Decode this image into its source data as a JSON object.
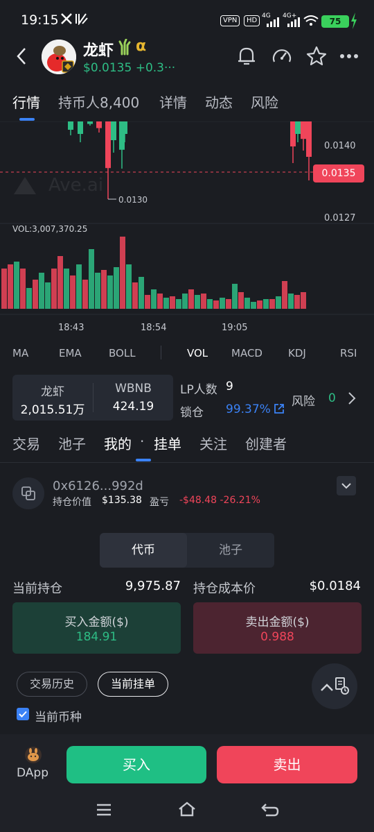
{
  "status_bar": {
    "time": "19:15",
    "vpn": "VPN",
    "hd": "HD",
    "net1": "4G",
    "net2": "4G+",
    "battery": "75"
  },
  "header": {
    "token_name": "龙虾",
    "alpha": "α",
    "price": "$0.0135",
    "change": "+0.3···"
  },
  "tabs": [
    {
      "label": "行情"
    },
    {
      "label": "持币人8,400"
    },
    {
      "label": "详情"
    },
    {
      "label": "动态"
    },
    {
      "label": "风险"
    }
  ],
  "chart_data": {
    "type": "candlestick",
    "price_ticks": [
      "0.0140",
      "0.0127"
    ],
    "low_label": "0.0130",
    "current_price": "0.0135",
    "watermark": "Ave.ai",
    "volume_label": "VOL:3,007,370.25",
    "time_ticks": [
      "18:43",
      "18:54",
      "19:05"
    ]
  },
  "indicators": [
    "MA",
    "EMA",
    "BOLL",
    "VOL",
    "MACD",
    "KDJ",
    "RSI"
  ],
  "pool": {
    "token_a_name": "龙虾",
    "token_a_amount": "2,015.51万",
    "token_b_name": "WBNB",
    "token_b_amount": "424.19",
    "lp_label": "LP人数",
    "lp_count": "9",
    "lock_label": "锁仓",
    "lock_pct": "99.37%",
    "risk_label": "风险",
    "risk_count": "0"
  },
  "sub_tabs": [
    {
      "label": "交易"
    },
    {
      "label": "池子"
    },
    {
      "label": "我的"
    },
    {
      "label": "挂单"
    },
    {
      "label": "关注"
    },
    {
      "label": "创建者"
    }
  ],
  "sub_dot": "·",
  "wallet": {
    "address": "0x6126...992d",
    "hold_value_label": "持仓价值",
    "hold_value": "$135.38",
    "pnl_label": "盈亏",
    "pnl": "-$48.48 -26.21%"
  },
  "segment": [
    "代币",
    "池子"
  ],
  "position": {
    "current_label": "当前持仓",
    "current_value": "9,975.87",
    "cost_label": "持仓成本价",
    "cost_value": "$0.0184"
  },
  "buy_box": {
    "label": "买入金额($)",
    "value": "184.91"
  },
  "sell_box": {
    "label": "卖出金额($)",
    "value": "0.988"
  },
  "pills": {
    "history": "交易历史",
    "orders": "当前挂单"
  },
  "checkbox_label": "当前币种",
  "bottom": {
    "dapp": "DApp",
    "buy": "买入",
    "sell": "卖出"
  }
}
